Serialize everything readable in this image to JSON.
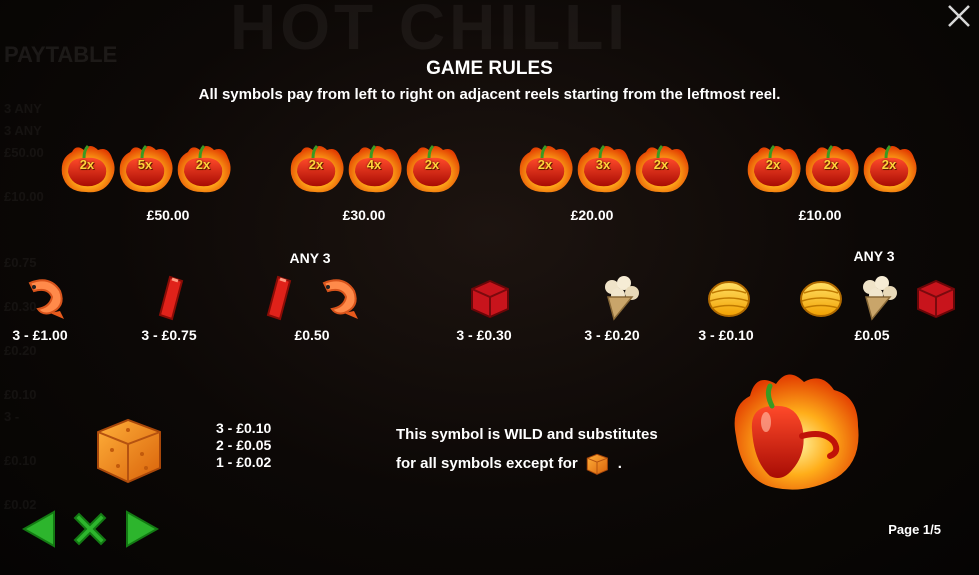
{
  "background": {
    "title": "HOT CHILLI",
    "paytable": "PAYTABLE",
    "column": "3 ANY\n3 ANY\n£50.00\n\n£10.00\n\n\n£0.75\n\n£0.30\n\n£0.20\n\n£0.10\n3 -\n\n£0.10\n\n£0.02"
  },
  "header": {
    "title": "GAME RULES",
    "subtitle": "All symbols pay from left to right on adjacent reels starting from the leftmost reel."
  },
  "multiplier_combos": [
    {
      "multipliers": [
        "2x",
        "5x",
        "2x"
      ],
      "prize": "£50.00"
    },
    {
      "multipliers": [
        "2x",
        "4x",
        "2x"
      ],
      "prize": "£30.00"
    },
    {
      "multipliers": [
        "2x",
        "3x",
        "2x"
      ],
      "prize": "£20.00"
    },
    {
      "multipliers": [
        "2x",
        "2x",
        "2x"
      ],
      "prize": "£10.00"
    }
  ],
  "symbols_row": {
    "shrimp_prize": "3 - £1.00",
    "pepper_prize": "3 - £0.75",
    "any3_left_label": "ANY 3",
    "any3_left_prize": "£0.50",
    "meat_prize": "3 - £0.30",
    "mushroom_prize": "3 - £0.20",
    "corn_prize": "3 - £0.10",
    "any3_right_label": "ANY 3",
    "any3_right_prize": "£0.05"
  },
  "cube_pays": [
    "3 - £0.10",
    "2 - £0.05",
    "1 - £0.02"
  ],
  "wild": {
    "line1": "This symbol is WILD and substitutes",
    "line2_prefix": "for all symbols except for",
    "line2_suffix": "."
  },
  "footer": {
    "page": "Page 1/5"
  },
  "colors": {
    "nav_green": "#2db52d",
    "multiplier_text": "#ffd23a",
    "chili_red": "#d8180c",
    "flame_orange": "#ff8a00"
  },
  "icons": [
    "close-icon",
    "chili-flame-icon",
    "shrimp-icon",
    "red-pepper-icon",
    "meat-cube-icon",
    "mushroom-cone-icon",
    "corn-icon",
    "cheese-cube-icon",
    "wild-chili-icon",
    "arrow-left-icon",
    "x-close-green-icon",
    "arrow-right-icon"
  ]
}
